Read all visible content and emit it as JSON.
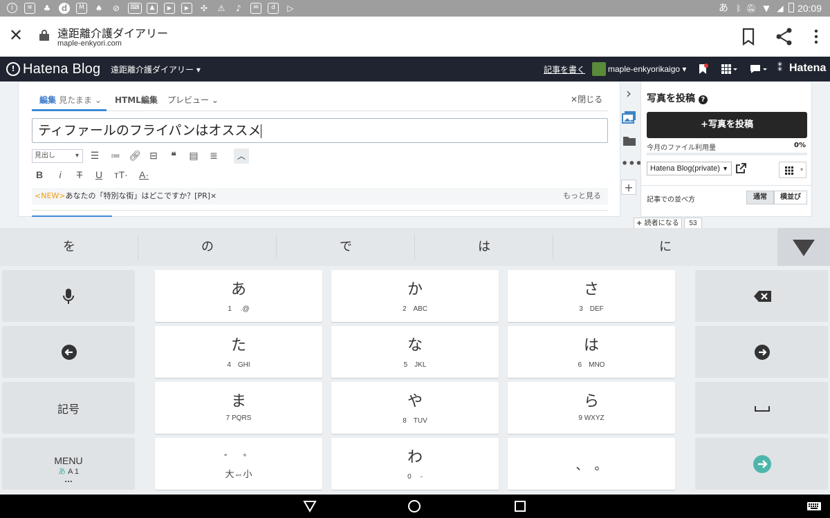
{
  "status_bar": {
    "time": "20:09",
    "ime_indicator": "あ",
    "left_icons": [
      "info-icon",
      "news-icon",
      "app-icon",
      "d-app-icon",
      "mail-icon",
      "app-icon",
      "no-signal-icon",
      "keyboard-icon",
      "image-icon",
      "youtube-icon",
      "youtube-icon",
      "pinwheel-icon",
      "warning-icon",
      "music-icon",
      "mail-icon",
      "d-box-icon",
      "play-store-icon"
    ],
    "right_icons": [
      "bluetooth-icon",
      "mute-icon",
      "wifi-icon",
      "signal-icon",
      "battery-icon"
    ]
  },
  "browser": {
    "page_title": "遠距離介護ダイアリー",
    "domain": "maple-enkyori.com"
  },
  "hatena_bar": {
    "logo": "Hatena Blog",
    "blog_name": "遠距離介護ダイアリー ▾",
    "write_link": "記事を書く",
    "username": "maple-enkyorikaigo ▾",
    "brand": "Hatena"
  },
  "editor": {
    "tab_edit": "編集",
    "tab_edit_mode": "見たまま",
    "tab_html": "HTML編集",
    "tab_preview": "プレビュー",
    "close": "閉じる",
    "title_value": "ティファールのフライパンはオススメ",
    "heading_select": "見出し",
    "promo_new": "<NEW>",
    "promo_text": "あなたの「特別な街」はどこですか？[PR]",
    "promo_more": "もっと見る"
  },
  "panel": {
    "title": "写真を投稿",
    "post_button": "写真を投稿",
    "usage_label": "今月のファイル利用量",
    "usage_percent": "0%",
    "usage_fraction": 0,
    "album": "Hatena Blog(private)",
    "sort_label": "記事での並べ方",
    "sort_normal": "通常",
    "sort_side": "横並び"
  },
  "reader": {
    "button": "読者になる",
    "count": "53"
  },
  "keyboard": {
    "candidates": [
      "を",
      "の",
      "で",
      "は",
      "に"
    ],
    "keys": [
      {
        "kana": "あ",
        "sub": "1　 .@"
      },
      {
        "kana": "か",
        "sub": "2　ABC"
      },
      {
        "kana": "さ",
        "sub": "3　DEF"
      },
      {
        "kana": "た",
        "sub": "4　GHI"
      },
      {
        "kana": "な",
        "sub": "5　JKL"
      },
      {
        "kana": "は",
        "sub": "6　MNO"
      },
      {
        "kana": "ま",
        "sub": "7 PQRS"
      },
      {
        "kana": "や",
        "sub": "8　TUV"
      },
      {
        "kana": "ら",
        "sub": "9 WXYZ"
      },
      {
        "kana": "゛　゜",
        "sub": "大⇔小"
      },
      {
        "kana": "わ",
        "sub": "0　 -"
      },
      {
        "kana": "、　。",
        "sub": ""
      }
    ],
    "symbol_key": "記号",
    "menu_key": "MENU",
    "menu_sub_kana": "あ",
    "menu_sub": "A 1",
    "menu_dots": "...",
    "accent": "#4db6ac"
  }
}
